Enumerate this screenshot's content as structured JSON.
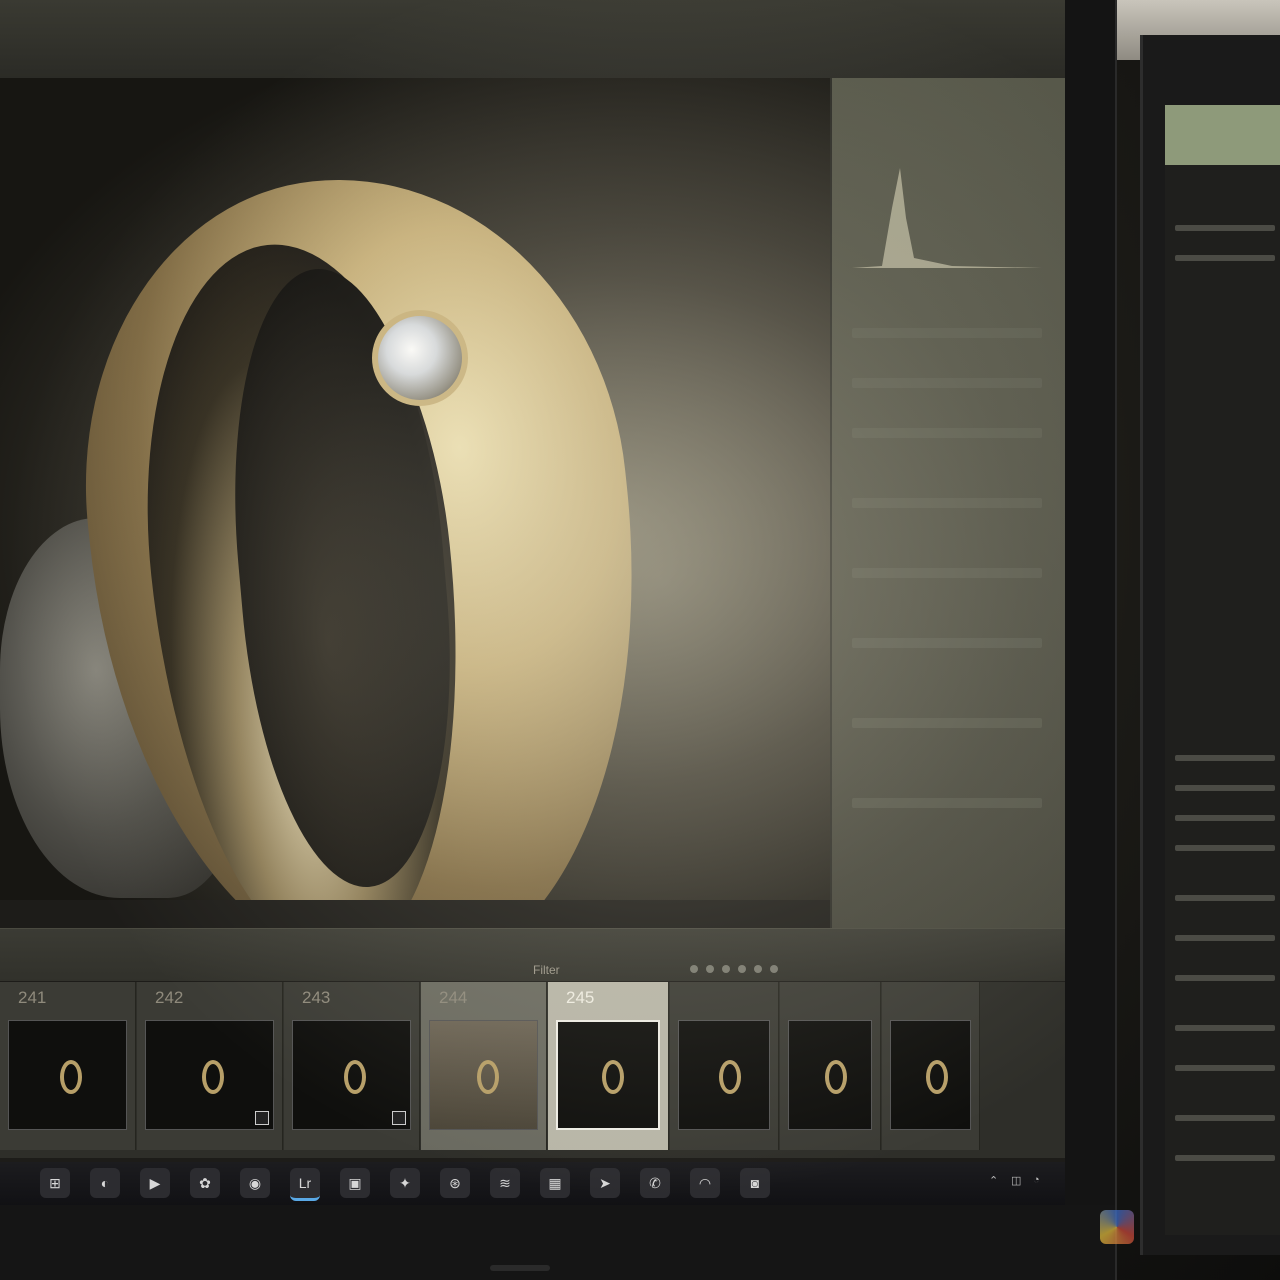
{
  "app": {
    "module_tabs": [
      "",
      ""
    ],
    "filter_label": "Filter"
  },
  "filmstrip": {
    "frames": [
      {
        "number": "241",
        "state": "normal",
        "badge": false
      },
      {
        "number": "242",
        "state": "normal",
        "badge": true
      },
      {
        "number": "243",
        "state": "normal",
        "badge": true
      },
      {
        "number": "244",
        "state": "highlight",
        "badge": false
      },
      {
        "number": "245",
        "state": "selected",
        "badge": false
      },
      {
        "number": "",
        "state": "normal",
        "badge": false
      },
      {
        "number": "",
        "state": "normal",
        "badge": false
      },
      {
        "number": "",
        "state": "normal",
        "badge": false
      }
    ]
  },
  "taskbar": {
    "icons": [
      {
        "name": "windows-start-icon",
        "glyph": "⊞"
      },
      {
        "name": "edge-browser-icon",
        "glyph": "◐"
      },
      {
        "name": "media-player-icon",
        "glyph": "▶"
      },
      {
        "name": "stamp-tool-icon",
        "glyph": "✿"
      },
      {
        "name": "antivirus-icon",
        "glyph": "◉"
      },
      {
        "name": "lightroom-classic-icon",
        "glyph": "Lr",
        "active": true
      },
      {
        "name": "photo-viewer-icon",
        "glyph": "▣"
      },
      {
        "name": "davinci-resolve-icon",
        "glyph": "✦"
      },
      {
        "name": "network-globe-icon",
        "glyph": "⊛"
      },
      {
        "name": "audio-waves-icon",
        "glyph": "≋"
      },
      {
        "name": "package-box-icon",
        "glyph": "▦"
      },
      {
        "name": "terminal-arrow-icon",
        "glyph": "➤"
      },
      {
        "name": "whatsapp-icon",
        "glyph": "✆"
      },
      {
        "name": "arc-app-icon",
        "glyph": "◠"
      },
      {
        "name": "archive-app-icon",
        "glyph": "◙"
      }
    ]
  },
  "colors": {
    "selected_frame": "#b8b6a8",
    "accent_taskbar": "#5aa9e6",
    "ring_gold": "#c7b07a"
  }
}
